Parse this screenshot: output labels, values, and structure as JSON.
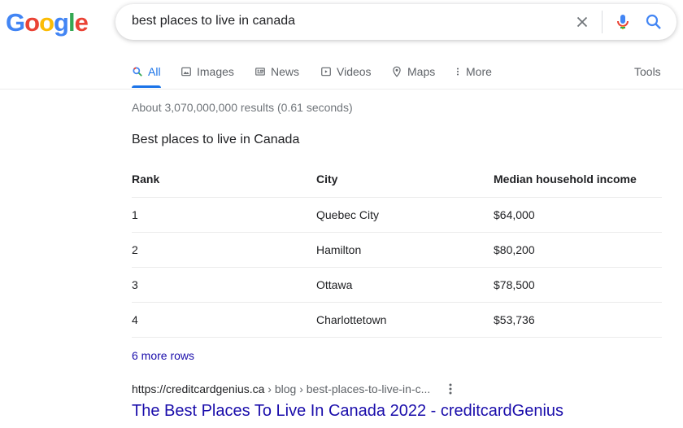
{
  "logo": {
    "letters": [
      "G",
      "o",
      "o",
      "g",
      "l",
      "e"
    ],
    "colors": [
      "#4285f4",
      "#ea4335",
      "#fbbc05",
      "#4285f4",
      "#34a853",
      "#ea4335"
    ]
  },
  "search": {
    "query": "best places to live in canada",
    "icons": [
      "close-icon",
      "microphone-icon",
      "search-icon"
    ]
  },
  "tabs": [
    {
      "label": "All",
      "icon": "search-icon",
      "active": true
    },
    {
      "label": "Images",
      "icon": "image-icon"
    },
    {
      "label": "News",
      "icon": "news-icon"
    },
    {
      "label": "Videos",
      "icon": "video-icon"
    },
    {
      "label": "Maps",
      "icon": "map-pin-icon"
    },
    {
      "label": "More",
      "icon": "more-vert-icon"
    }
  ],
  "tools_label": "Tools",
  "result_stats": "About 3,070,000,000 results (0.61 seconds)",
  "snippet": {
    "title": "Best places to live in Canada",
    "headers": [
      "Rank",
      "City",
      "Median household income"
    ],
    "rows": [
      [
        "1",
        "Quebec City",
        "$64,000"
      ],
      [
        "2",
        "Hamilton",
        "$80,200"
      ],
      [
        "3",
        "Ottawa",
        "$78,500"
      ],
      [
        "4",
        "Charlottetown",
        "$53,736"
      ]
    ],
    "more_rows": "6 more rows"
  },
  "result": {
    "domain": "https://creditcardgenius.ca",
    "breadcrumb": " › blog › best-places-to-live-in-c...",
    "title": "The Best Places To Live In Canada 2022 - creditcardGenius"
  },
  "colors": {
    "accent": "#1a73e8",
    "link": "#1a0dab"
  }
}
